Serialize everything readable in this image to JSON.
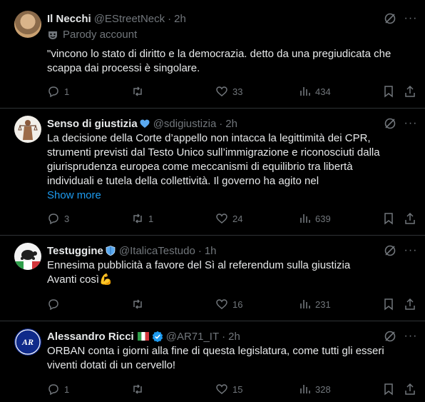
{
  "tweets": [
    {
      "name": "Il Necchi",
      "handle": "@EStreetNeck",
      "dot": "·",
      "time": "2h",
      "parody_label": "Parody account",
      "text": "\"vincono lo stato di diritto e la democrazia. detto da una pregiudicata che scappa dai processi è singolare.",
      "replies": "1",
      "reposts": "",
      "likes": "33",
      "views": "434"
    },
    {
      "name": "Senso di giustizia",
      "handle": "@sdigiustizia",
      "dot": "·",
      "time": "2h",
      "text_lines": [
        "La decisione della Corte d’appello non intacca la legittimità dei CPR,",
        "strumenti previsti dal Testo Unico sull’immigrazione e riconosciuti dalla",
        "giurisprudenza europea come meccanismi di equilibrio tra libertà",
        "individuali e tutela della collettività. Il governo ha agito nel"
      ],
      "show_more": "Show more",
      "replies": "3",
      "reposts": "1",
      "likes": "24",
      "views": "639"
    },
    {
      "name": "Testuggine",
      "handle": "@ItalicaTestudo",
      "dot": "·",
      "time": "1h",
      "text_line1": "Ennesima pubblicità a favore del Sì al referendum sulla giustizia",
      "text_line2": "Avanti così",
      "emoji": "💪",
      "replies": "",
      "reposts": "",
      "likes": "16",
      "views": "231"
    },
    {
      "name": "Alessandro Ricci",
      "handle": "@AR71_IT",
      "dot": "·",
      "time": "2h",
      "text_line1": "ORBAN conta i giorni alla fine di questa legislatura, come tutti gli esseri",
      "text_line2": "viventi dotati di un cervello!",
      "replies": "1",
      "reposts": "",
      "likes": "15",
      "views": "328"
    }
  ],
  "more_glyph": "···",
  "colors": {
    "accent": "#1d9bf0",
    "muted": "#71767b",
    "text": "#e7e9ea",
    "divider": "#2f3336"
  }
}
